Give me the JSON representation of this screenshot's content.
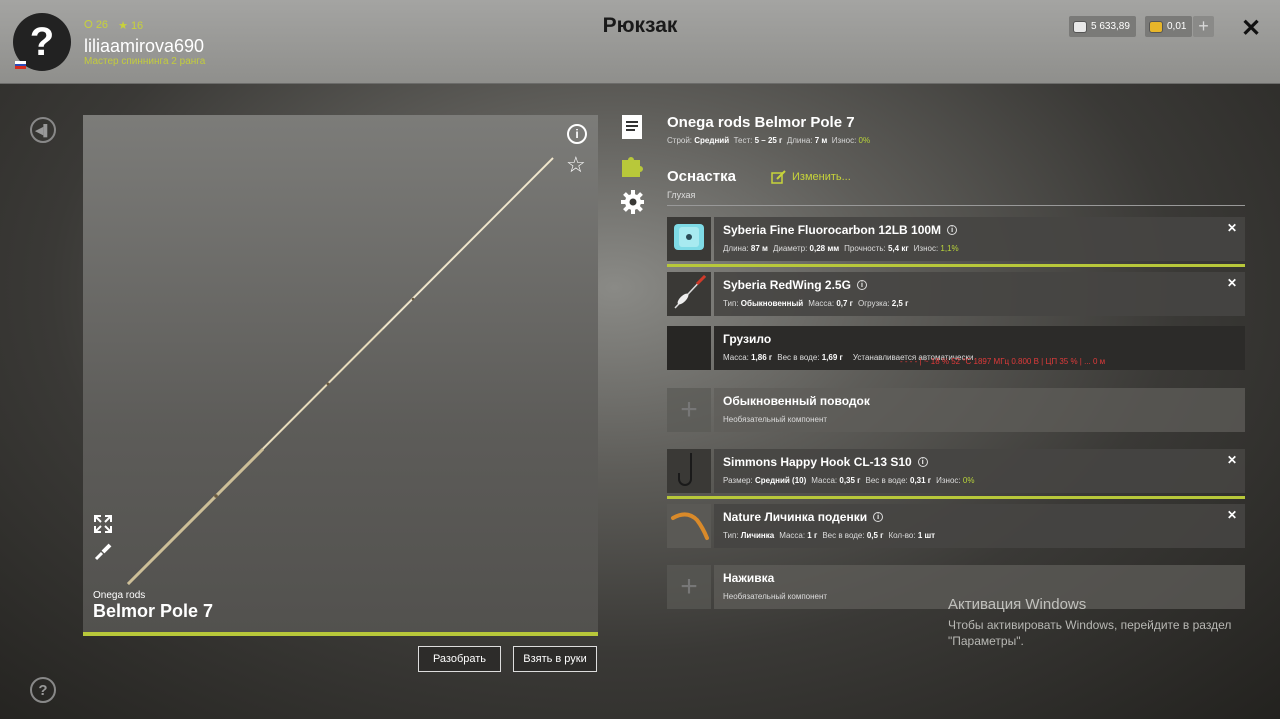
{
  "header": {
    "title": "Рюкзак",
    "avatar_glyph": "?",
    "stat_level": "26",
    "stat_stars": "16",
    "username": "liliaamirova690",
    "rank": "Мастер спиннинга 2 ранга",
    "silver": "5 633,89",
    "gold": "0,01",
    "add_label": "+",
    "close_label": "✕"
  },
  "left": {
    "brand_small": "Onega rods",
    "brand_big": "Belmor Pole 7",
    "disassemble_label": "Разобрать",
    "take_label": "Взять в руки"
  },
  "rod": {
    "title": "Onega rods Belmor Pole 7",
    "k1": "Строй:",
    "v1": "Средний",
    "k2": "Тест:",
    "v2": "5 – 25 г",
    "k3": "Длина:",
    "v3": "7 м",
    "k4": "Износ:",
    "v4": "0%"
  },
  "tackle": {
    "title": "Оснастка",
    "edit_label": "Изменить...",
    "subtitle": "Глухая"
  },
  "slots": [
    {
      "name": "Syberia Fine Fluorocarbon 12LB 100M",
      "k1": "Длина:",
      "v1": "87 м",
      "k2": "Диаметр:",
      "v2": "0,28 мм",
      "k3": "Прочность:",
      "v3": "5,4 кг",
      "k4": "Износ:",
      "v4": "1,1%"
    },
    {
      "name": "Syberia RedWing 2.5G",
      "k1": "Тип:",
      "v1": "Обыкновенный",
      "k2": "Масса:",
      "v2": "0,7 г",
      "k3": "Огрузка:",
      "v3": "2,5 г"
    },
    {
      "name": "Грузило",
      "k1": "Масса:",
      "v1": "1,86 г",
      "k2": "Вес в воде:",
      "v2": "1,69 г",
      "note": "Устанавливается автоматически"
    },
    {
      "name": "Обыкновенный поводок",
      "note": "Необязательный компонент"
    },
    {
      "name": "Simmons Happy Hook CL-13 S10",
      "k1": "Размер:",
      "v1": "Средний (10)",
      "k2": "Масса:",
      "v2": "0,35 г",
      "k3": "Вес в воде:",
      "v3": "0,31 г",
      "k4": "Износ:",
      "v4": "0%"
    },
    {
      "name": "Nature Личинка поденки",
      "k1": "Тип:",
      "v1": "Личинка",
      "k2": "Масса:",
      "v2": "1 г",
      "k3": "Вес в воде:",
      "v3": "0,5 г",
      "k4": "Кол-во:",
      "v4": "1 шт"
    },
    {
      "name": "Наживка",
      "note": "Необязательный компонент"
    }
  ],
  "overlay_text": "- - - -  |  ~ 18 %  52 °C  1897 МГц  0.800 В  |  ЦП 35 %  |  ... 0 м",
  "activation": {
    "title": "Активация Windows",
    "line1": "Чтобы активировать Windows, перейдите в раздел",
    "line2": "\"Параметры\"."
  },
  "colors": {
    "accent": "#b8c83a",
    "gold_text": "#c8d23a",
    "header_bg": "#9b9b99"
  }
}
